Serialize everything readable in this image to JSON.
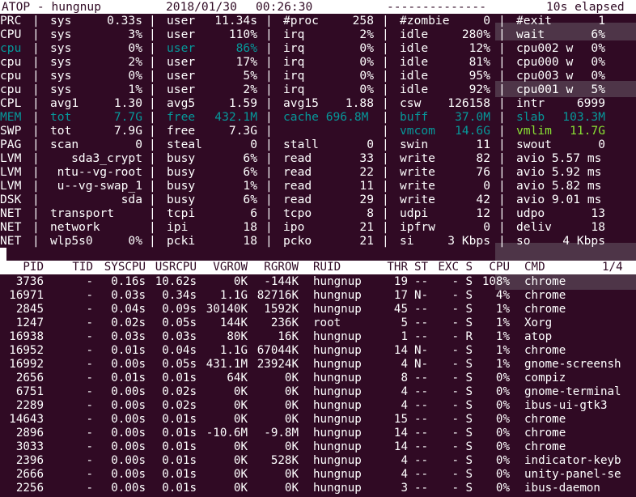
{
  "title_bar": {
    "app": "ATOP - hungnup",
    "date": "2018/01/30",
    "time": "00:26:30",
    "dashes": "--------------",
    "elapsed": "10s elapsed"
  },
  "system_lines": [
    {
      "label": "PRC",
      "cells": [
        [
          "sys",
          "0.33s"
        ],
        [
          "user",
          "11.34s"
        ],
        [
          "#proc",
          "258"
        ],
        [
          "#zombie",
          "0"
        ],
        [
          "#exit",
          "1"
        ]
      ]
    },
    {
      "label": "CPU",
      "cells": [
        [
          "sys",
          "3%"
        ],
        [
          "user",
          "110%"
        ],
        [
          "irq",
          "2%"
        ],
        [
          "idle",
          "280%"
        ],
        [
          "wait",
          "6%"
        ]
      ]
    },
    {
      "label": "cpu",
      "cells": [
        [
          "sys",
          "0%"
        ],
        [
          "user",
          "86%"
        ],
        [
          "irq",
          "0%"
        ],
        [
          "idle",
          "12%"
        ],
        [
          "cpu002 w",
          "0%"
        ]
      ]
    },
    {
      "label": "cpu",
      "cells": [
        [
          "sys",
          "2%"
        ],
        [
          "user",
          "17%"
        ],
        [
          "irq",
          "0%"
        ],
        [
          "idle",
          "81%"
        ],
        [
          "cpu000 w",
          "0%"
        ]
      ]
    },
    {
      "label": "cpu",
      "cells": [
        [
          "sys",
          "0%"
        ],
        [
          "user",
          "5%"
        ],
        [
          "irq",
          "0%"
        ],
        [
          "idle",
          "95%"
        ],
        [
          "cpu003 w",
          "0%"
        ]
      ]
    },
    {
      "label": "cpu",
      "cells": [
        [
          "sys",
          "1%"
        ],
        [
          "user",
          "2%"
        ],
        [
          "irq",
          "0%"
        ],
        [
          "idle",
          "92%"
        ],
        [
          "cpu001 w",
          "5%"
        ]
      ]
    },
    {
      "label": "CPL",
      "cells": [
        [
          "avg1",
          "1.30"
        ],
        [
          "avg5",
          "1.59"
        ],
        [
          "avg15",
          "1.88"
        ],
        [
          "csw",
          "126158"
        ],
        [
          "intr",
          "6999"
        ]
      ]
    },
    {
      "label": "MEM",
      "cells": [
        [
          "tot",
          "7.7G"
        ],
        [
          "free",
          "432.1M"
        ],
        [
          "cache 696.8M",
          ""
        ],
        [
          "buff",
          "37.0M"
        ],
        [
          "slab",
          "103.3M"
        ]
      ]
    },
    {
      "label": "SWP",
      "cells": [
        [
          "tot",
          "7.9G"
        ],
        [
          "free",
          "7.3G"
        ],
        [
          "",
          ""
        ],
        [
          "vmcom",
          "14.6G"
        ],
        [
          "vmlim",
          "11.7G"
        ]
      ]
    },
    {
      "label": "PAG",
      "cells": [
        [
          "scan",
          "0"
        ],
        [
          "steal",
          "0"
        ],
        [
          "stall",
          "0"
        ],
        [
          "swin",
          "11"
        ],
        [
          "swout",
          "0"
        ]
      ]
    },
    {
      "label": "LVM",
      "cells": [
        [
          "sda3_crypt",
          ""
        ],
        [
          "busy",
          "6%"
        ],
        [
          "read",
          "33"
        ],
        [
          "write",
          "82"
        ],
        [
          "avio 5.57 ms",
          ""
        ]
      ]
    },
    {
      "label": "LVM",
      "cells": [
        [
          "ntu--vg-root",
          ""
        ],
        [
          "busy",
          "6%"
        ],
        [
          "read",
          "22"
        ],
        [
          "write",
          "76"
        ],
        [
          "avio 5.92 ms",
          ""
        ]
      ]
    },
    {
      "label": "LVM",
      "cells": [
        [
          "u--vg-swap_1",
          ""
        ],
        [
          "busy",
          "1%"
        ],
        [
          "read",
          "11"
        ],
        [
          "write",
          "0"
        ],
        [
          "avio 5.82 ms",
          ""
        ]
      ]
    },
    {
      "label": "DSK",
      "cells": [
        [
          "sda",
          ""
        ],
        [
          "busy",
          "6%"
        ],
        [
          "read",
          "29"
        ],
        [
          "write",
          "42"
        ],
        [
          "avio 9.01 ms",
          ""
        ]
      ]
    },
    {
      "label": "NET",
      "cells": [
        [
          "transport",
          ""
        ],
        [
          "tcpi",
          "6"
        ],
        [
          "tcpo",
          "8"
        ],
        [
          "udpi",
          "12"
        ],
        [
          "udpo",
          "13"
        ]
      ]
    },
    {
      "label": "NET",
      "cells": [
        [
          "network",
          ""
        ],
        [
          "ipi",
          "18"
        ],
        [
          "ipo",
          "21"
        ],
        [
          "ipfrw",
          "0"
        ],
        [
          "deliv",
          "18"
        ]
      ]
    },
    {
      "label": "NET",
      "cells": [
        [
          "wlp5s0",
          "0%"
        ],
        [
          "pcki",
          "18"
        ],
        [
          "pcko",
          "21"
        ],
        [
          "si",
          "3 Kbps"
        ],
        [
          "so",
          "4 Kbps"
        ]
      ]
    }
  ],
  "process_table": {
    "columns": [
      "PID",
      "TID",
      "SYSCPU",
      "USRCPU",
      "VGROW",
      "RGROW",
      "RUID",
      "THR",
      "ST",
      "EXC",
      "S",
      "CPU",
      "CMD"
    ],
    "page": "1/4",
    "rows": [
      [
        "3736",
        "-",
        "0.16s",
        "10.62s",
        "0K",
        "-144K",
        "hungnup",
        "19",
        "--",
        "-",
        "S",
        "108%",
        "chrome"
      ],
      [
        "16971",
        "-",
        "0.03s",
        "0.34s",
        "1.1G",
        "82716K",
        "hungnup",
        "17",
        "N-",
        "-",
        "S",
        "4%",
        "chrome"
      ],
      [
        "2845",
        "-",
        "0.04s",
        "0.09s",
        "30140K",
        "1592K",
        "hungnup",
        "45",
        "--",
        "-",
        "S",
        "1%",
        "chrome"
      ],
      [
        "1247",
        "-",
        "0.02s",
        "0.05s",
        "144K",
        "236K",
        "root",
        "5",
        "--",
        "-",
        "S",
        "1%",
        "Xorg"
      ],
      [
        "16938",
        "-",
        "0.03s",
        "0.03s",
        "80K",
        "16K",
        "hungnup",
        "1",
        "--",
        "-",
        "R",
        "1%",
        "atop"
      ],
      [
        "16952",
        "-",
        "0.01s",
        "0.04s",
        "1.1G",
        "67044K",
        "hungnup",
        "14",
        "N-",
        "-",
        "S",
        "1%",
        "chrome"
      ],
      [
        "16992",
        "-",
        "0.00s",
        "0.05s",
        "431.1M",
        "23924K",
        "hungnup",
        "4",
        "N-",
        "-",
        "S",
        "1%",
        "gnome-screensh"
      ],
      [
        "2656",
        "-",
        "0.01s",
        "0.01s",
        "64K",
        "0K",
        "hungnup",
        "8",
        "--",
        "-",
        "S",
        "0%",
        "compiz"
      ],
      [
        "6751",
        "-",
        "0.00s",
        "0.02s",
        "0K",
        "0K",
        "hungnup",
        "4",
        "--",
        "-",
        "S",
        "0%",
        "gnome-terminal"
      ],
      [
        "2289",
        "-",
        "0.00s",
        "0.02s",
        "0K",
        "0K",
        "hungnup",
        "4",
        "--",
        "-",
        "S",
        "0%",
        "ibus-ui-gtk3"
      ],
      [
        "14643",
        "-",
        "0.00s",
        "0.01s",
        "0K",
        "0K",
        "hungnup",
        "15",
        "--",
        "-",
        "S",
        "0%",
        "chrome"
      ],
      [
        "2896",
        "-",
        "0.00s",
        "0.01s",
        "-10.6M",
        "-9.8M",
        "hungnup",
        "14",
        "--",
        "-",
        "S",
        "0%",
        "chrome"
      ],
      [
        "3033",
        "-",
        "0.00s",
        "0.01s",
        "0K",
        "0K",
        "hungnup",
        "14",
        "--",
        "-",
        "S",
        "0%",
        "chrome"
      ],
      [
        "2396",
        "-",
        "0.00s",
        "0.01s",
        "0K",
        "528K",
        "hungnup",
        "4",
        "--",
        "-",
        "S",
        "0%",
        "indicator-keyb"
      ],
      [
        "2666",
        "-",
        "0.00s",
        "0.01s",
        "0K",
        "0K",
        "hungnup",
        "4",
        "--",
        "-",
        "S",
        "0%",
        "unity-panel-se"
      ],
      [
        "2256",
        "-",
        "0.00s",
        "0.01s",
        "0K",
        "0K",
        "hungnup",
        "3",
        "--",
        "-",
        "S",
        "0%",
        "ibus-daemon"
      ]
    ]
  },
  "colors": {
    "terminal_bg": "#300a24",
    "text": "#ffffff",
    "highlight_cyan": "#34e2e2",
    "highlight_green": "#8ae234"
  }
}
